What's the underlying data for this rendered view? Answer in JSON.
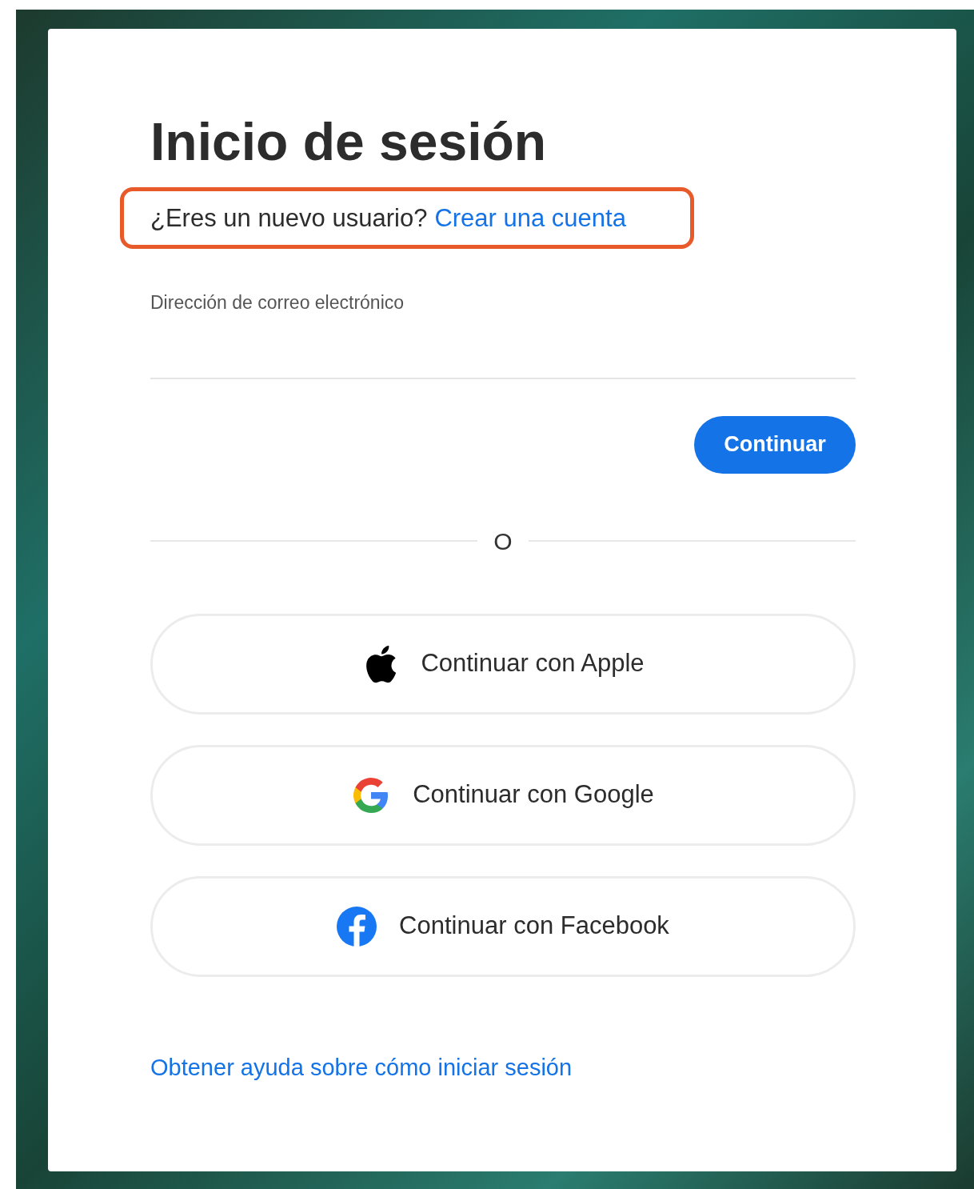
{
  "title": "Inicio de sesión",
  "new_user": {
    "prompt": "¿Eres un nuevo usuario?",
    "link": "Crear una cuenta",
    "highlighted": true
  },
  "email_field": {
    "label": "Dirección de correo electrónico"
  },
  "continue_button": "Continuar",
  "divider": "O",
  "social_buttons": [
    {
      "kind": "apple",
      "label": "Continuar con Apple"
    },
    {
      "kind": "google",
      "label": "Continuar con Google"
    },
    {
      "kind": "facebook",
      "label": "Continuar con Facebook"
    }
  ],
  "help_link": "Obtener ayuda sobre cómo iniciar sesión"
}
